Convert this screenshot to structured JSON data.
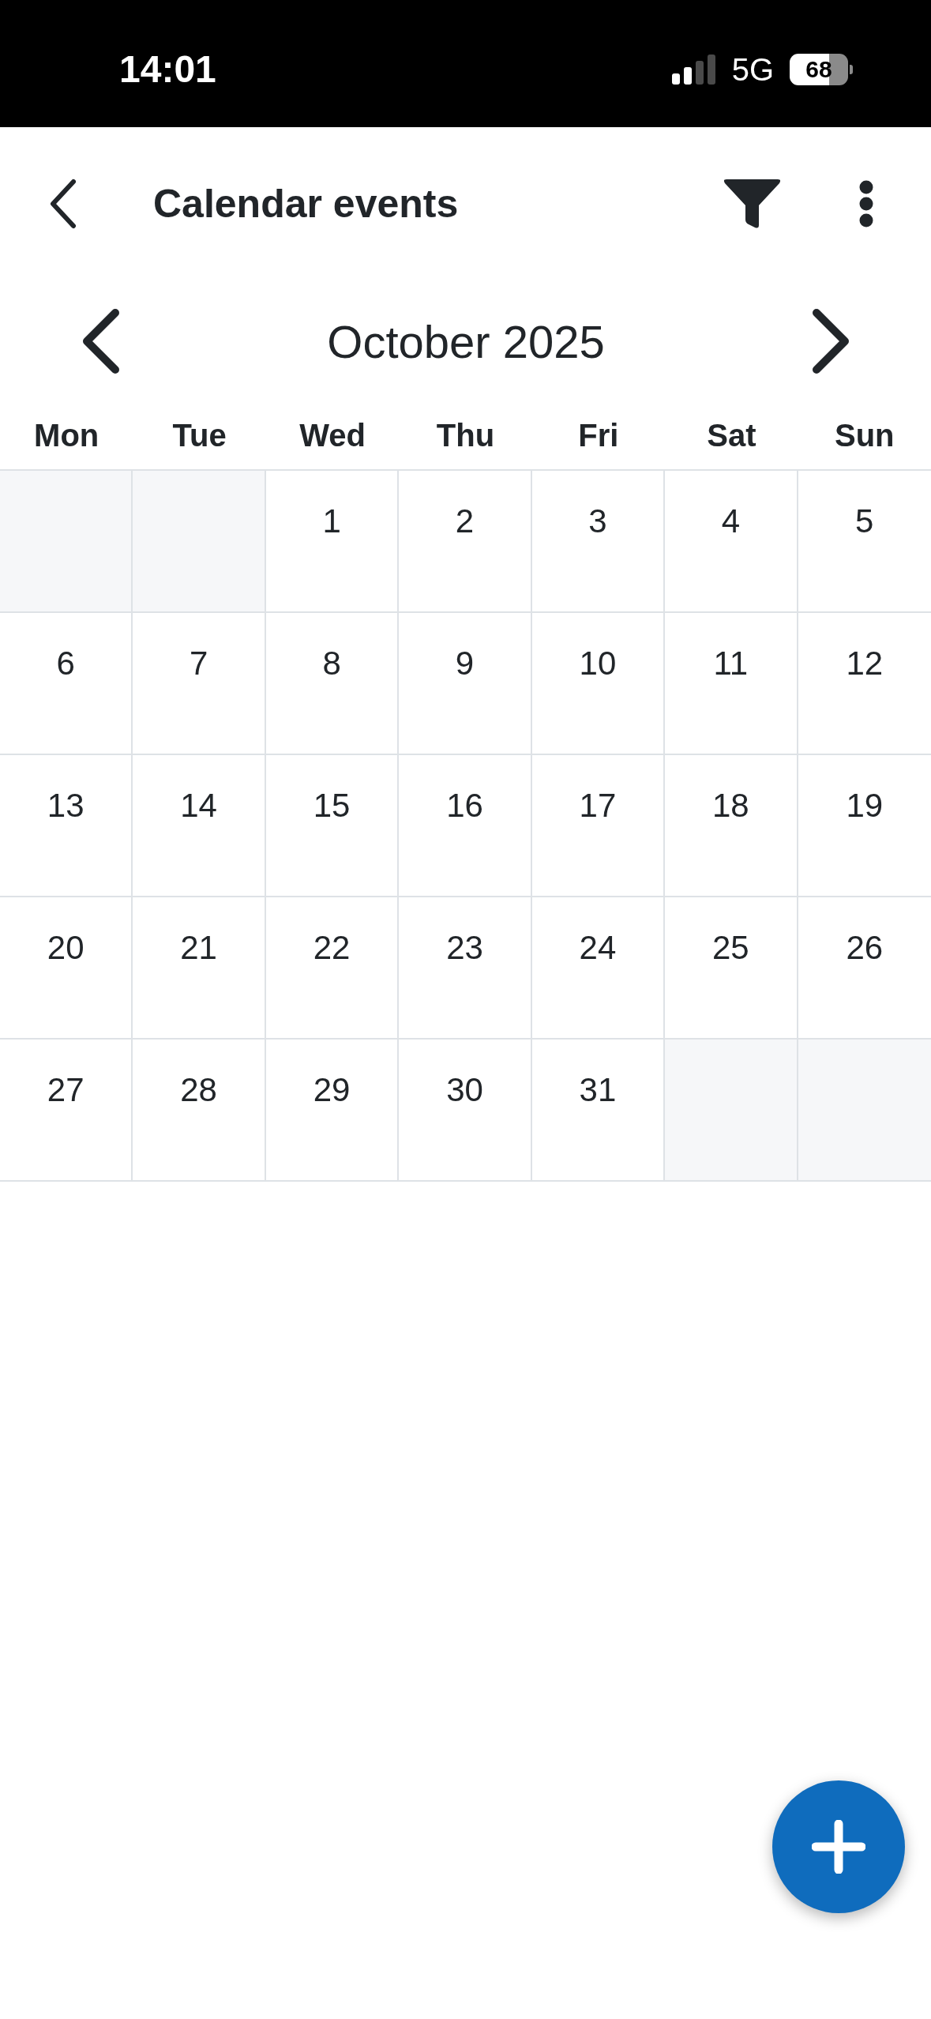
{
  "status_bar": {
    "time": "14:01",
    "network": "5G",
    "battery": "68"
  },
  "header": {
    "title": "Calendar events"
  },
  "month_nav": {
    "title": "October 2025"
  },
  "weekdays": [
    "Mon",
    "Tue",
    "Wed",
    "Thu",
    "Fri",
    "Sat",
    "Sun"
  ],
  "weeks": [
    {
      "days": [
        {
          "kind": "blank"
        },
        {
          "kind": "blank"
        },
        {
          "kind": "day",
          "label": "1"
        },
        {
          "kind": "day",
          "label": "2"
        },
        {
          "kind": "day",
          "label": "3"
        },
        {
          "kind": "day",
          "label": "4"
        },
        {
          "kind": "day",
          "label": "5"
        }
      ]
    },
    {
      "days": [
        {
          "kind": "day",
          "label": "6"
        },
        {
          "kind": "day",
          "label": "7"
        },
        {
          "kind": "day",
          "label": "8"
        },
        {
          "kind": "day",
          "label": "9"
        },
        {
          "kind": "day",
          "label": "10"
        },
        {
          "kind": "day",
          "label": "11"
        },
        {
          "kind": "day",
          "label": "12"
        }
      ]
    },
    {
      "days": [
        {
          "kind": "day",
          "label": "13"
        },
        {
          "kind": "day",
          "label": "14"
        },
        {
          "kind": "day",
          "label": "15"
        },
        {
          "kind": "day",
          "label": "16"
        },
        {
          "kind": "day",
          "label": "17"
        },
        {
          "kind": "day",
          "label": "18"
        },
        {
          "kind": "day",
          "label": "19"
        }
      ]
    },
    {
      "days": [
        {
          "kind": "day",
          "label": "20"
        },
        {
          "kind": "day",
          "label": "21"
        },
        {
          "kind": "day",
          "label": "22"
        },
        {
          "kind": "day",
          "label": "23"
        },
        {
          "kind": "day",
          "label": "24"
        },
        {
          "kind": "day",
          "label": "25"
        },
        {
          "kind": "day",
          "label": "26"
        }
      ]
    },
    {
      "days": [
        {
          "kind": "day",
          "label": "27"
        },
        {
          "kind": "day",
          "label": "28"
        },
        {
          "kind": "day",
          "label": "29"
        },
        {
          "kind": "day",
          "label": "30"
        },
        {
          "kind": "day",
          "label": "31"
        },
        {
          "kind": "blank"
        },
        {
          "kind": "blank"
        }
      ]
    }
  ]
}
